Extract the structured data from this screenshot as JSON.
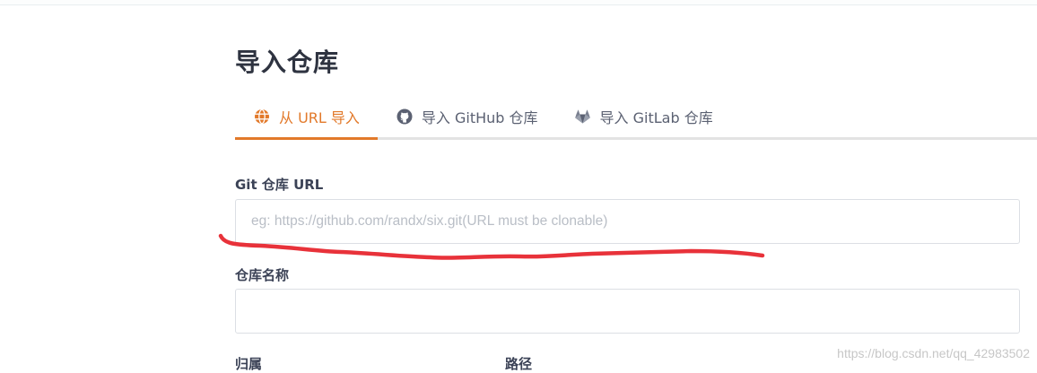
{
  "page": {
    "title": "导入仓库"
  },
  "tabs": [
    {
      "label": "从 URL 导入",
      "icon": "globe-icon",
      "active": true
    },
    {
      "label": "导入 GitHub 仓库",
      "icon": "github-icon",
      "active": false
    },
    {
      "label": "导入 GitLab 仓库",
      "icon": "gitlab-icon",
      "active": false
    }
  ],
  "form": {
    "git_url": {
      "label": "Git 仓库 URL",
      "value": "",
      "placeholder": "eg: https://github.com/randx/six.git(URL must be clonable)"
    },
    "repo_name": {
      "label": "仓库名称",
      "value": "",
      "placeholder": ""
    },
    "owner": {
      "label": "归属"
    },
    "path": {
      "label": "路径"
    }
  },
  "watermark": "https://blog.csdn.net/qq_42983502",
  "colors": {
    "accent": "#e2792a",
    "annotation": "#e8323a"
  }
}
